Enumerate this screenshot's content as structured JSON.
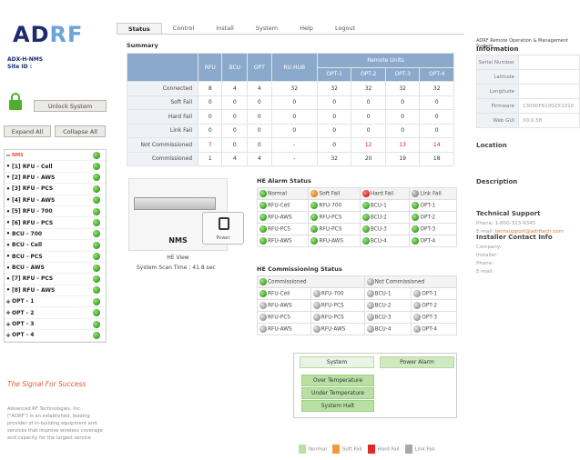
{
  "brand": {
    "logo_main": "AD",
    "logo_accent": "RF"
  },
  "sidebar": {
    "device_name": "ADX-H-NMS",
    "site_id": "Site ID :",
    "unlock_label": "Unlock System",
    "expand_label": "Expand All",
    "collapse_label": "Collapse All",
    "tree": [
      {
        "exp": "−",
        "label": "NMS",
        "root": true
      },
      {
        "exp": "•",
        "label": "[1] RFU - Cell"
      },
      {
        "exp": "•",
        "label": "[2] RFU - AWS"
      },
      {
        "exp": "•",
        "label": "[3] RFU - PCS"
      },
      {
        "exp": "•",
        "label": "[4] RFU - AWS"
      },
      {
        "exp": "•",
        "label": "[5] RFU - 700"
      },
      {
        "exp": "•",
        "label": "[6] RFU - PCS"
      },
      {
        "exp": "•",
        "label": "BCU - 700"
      },
      {
        "exp": "•",
        "label": "BCU - Cell"
      },
      {
        "exp": "•",
        "label": "BCU - PCS"
      },
      {
        "exp": "•",
        "label": "BCU - AWS"
      },
      {
        "exp": "•",
        "label": "[7] RFU - PCS"
      },
      {
        "exp": "•",
        "label": "[8] RFU - AWS"
      },
      {
        "exp": "+",
        "label": "OPT - 1"
      },
      {
        "exp": "+",
        "label": "OPT - 2"
      },
      {
        "exp": "+",
        "label": "OPT - 3"
      },
      {
        "exp": "+",
        "label": "OPT - 4"
      }
    ],
    "tagline": "The Signal For Success",
    "about": "Advanced RF Technologies, Inc. (\"ADRF\") is an established, leading provider of in-building equipment and services that improve wireless coverage and capacity for the largest service"
  },
  "tabs": [
    "Status",
    "Control",
    "Install",
    "System",
    "Help",
    "Logout"
  ],
  "summary": {
    "title": "Summary",
    "columns": [
      "RFU",
      "BCU",
      "OPT",
      "RU-HUB"
    ],
    "remote_group": "Remote Units",
    "remote_cols": [
      "OPT-1",
      "OPT-2",
      "OPT-3",
      "OPT-4"
    ],
    "rows": [
      {
        "label": "Connected",
        "vals": [
          "8",
          "4",
          "4",
          "32",
          "32",
          "32",
          "32",
          "32"
        ]
      },
      {
        "label": "Soft Fail",
        "vals": [
          "0",
          "0",
          "0",
          "0",
          "0",
          "0",
          "0",
          "0"
        ]
      },
      {
        "label": "Hard Fail",
        "vals": [
          "0",
          "0",
          "0",
          "0",
          "0",
          "0",
          "0",
          "0"
        ]
      },
      {
        "label": "Link Fail",
        "vals": [
          "0",
          "0",
          "0",
          "0",
          "0",
          "0",
          "0",
          "0"
        ]
      },
      {
        "label": "Not Commissioned",
        "vals": [
          "7",
          "0",
          "0",
          "-",
          "0",
          "12",
          "13",
          "14"
        ]
      },
      {
        "label": "Commissioned",
        "vals": [
          "1",
          "4",
          "4",
          "-",
          "32",
          "20",
          "19",
          "18"
        ]
      }
    ]
  },
  "he": {
    "nms_label": "NMS",
    "power_label": "Power",
    "view_label": "HE View",
    "scan_time": "System Scan Time : 41.8 sec"
  },
  "alarm": {
    "title": "HE Alarm Status",
    "legend": [
      "Normal",
      "Soft Fail",
      "Hard Fail",
      "Link Fail"
    ],
    "rows": [
      [
        "RFU-Cell",
        "RFU-700",
        "BCU-1",
        "OPT-1"
      ],
      [
        "RFU-AWS",
        "RFU-PCS",
        "BCU-2",
        "OPT-2"
      ],
      [
        "RFU-PCS",
        "RFU-PCS",
        "BCU-3",
        "OPT-3"
      ],
      [
        "RFU-AWS",
        "RFU-AWS",
        "BCU-4",
        "OPT-4"
      ]
    ]
  },
  "commission": {
    "title": "HE Commissioning Status",
    "legend": [
      "Commissioned",
      "Not Commissioned"
    ],
    "rows": [
      [
        "RFU-Cell",
        "RFU-700",
        "BCU-1",
        "OPT-1"
      ],
      [
        "RFU-AWS",
        "RFU-PCS",
        "BCU-2",
        "OPT-2"
      ],
      [
        "RFU-PCS",
        "RFU-PCS",
        "BCU-3",
        "OPT-3"
      ],
      [
        "RFU-AWS",
        "RFU-AWS",
        "BCU-4",
        "OPT-4"
      ]
    ]
  },
  "system_box": {
    "system_label": "System",
    "power_alarm_label": "Power Alarm",
    "items": [
      "Over Temperature",
      "Under Temperature",
      "System Halt"
    ]
  },
  "bottom_legend": [
    "Normal",
    "Soft Fail",
    "Hard Fail",
    "Link Fail"
  ],
  "right": {
    "header_line": "ADRF Remote Operation & Management System",
    "info_title": "Information",
    "info": [
      {
        "k": "Serial Number",
        "v": ""
      },
      {
        "k": "Latitude",
        "v": ""
      },
      {
        "k": "Longitude",
        "v": ""
      },
      {
        "k": "Firmware",
        "v": "13000F6100ZX1010"
      },
      {
        "k": "Web GUI",
        "v": "X0.0.58"
      }
    ],
    "location_title": "Location",
    "description_title": "Description",
    "support_title": "Technical Support",
    "support_phone": "Phone: 1-800-313-9345",
    "support_email_label": "E-mail: ",
    "support_email": "techsupport@adrftech.com",
    "installer_title": "Installer Contact Info",
    "installer_company": "Company:",
    "installer_name": "Installer:",
    "installer_phone": "Phone:",
    "installer_email": "E-mail:"
  },
  "colors": {
    "accent_green": "#3ba323",
    "header_blue": "#8ba9ca",
    "tagline_orange": "#e05a2b"
  }
}
